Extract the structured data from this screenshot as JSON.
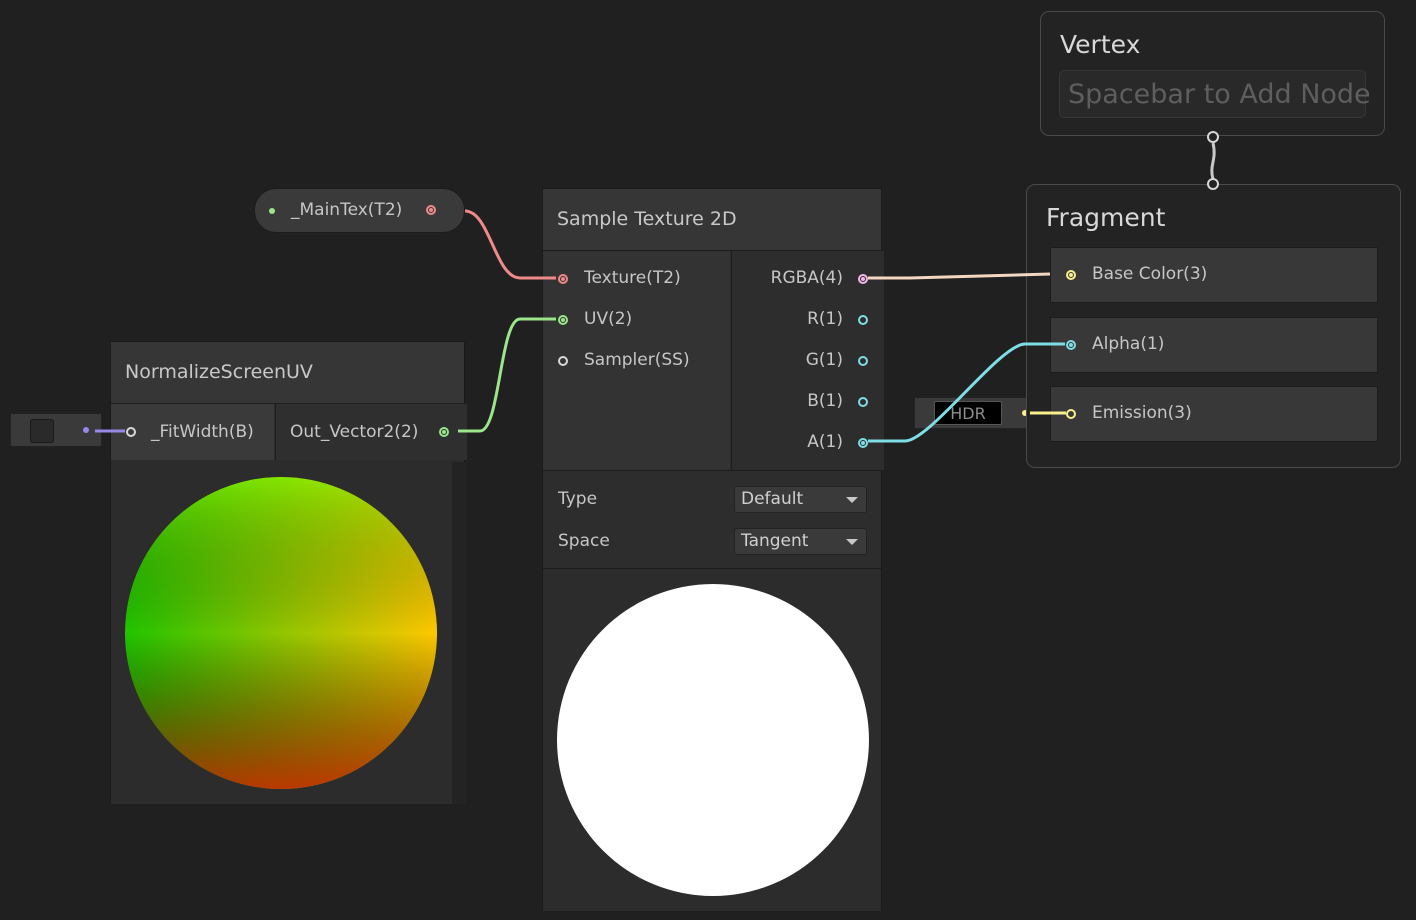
{
  "graph": {
    "property_node": {
      "label": "_MainTex(T2)"
    },
    "sample_texture": {
      "title": "Sample Texture 2D",
      "inputs": [
        "Texture(T2)",
        "UV(2)",
        "Sampler(SS)"
      ],
      "outputs": [
        "RGBA(4)",
        "R(1)",
        "G(1)",
        "B(1)",
        "A(1)"
      ],
      "settings": {
        "type_label": "Type",
        "type_value": "Default",
        "space_label": "Space",
        "space_value": "Tangent"
      }
    },
    "normalize_node": {
      "title": "NormalizeScreenUV",
      "input": "_FitWidth(B)",
      "output": "Out_Vector2(2)"
    },
    "vertex_context": {
      "title": "Vertex",
      "placeholder": "Spacebar to Add Node"
    },
    "fragment_context": {
      "title": "Fragment",
      "blocks": [
        "Base Color(3)",
        "Alpha(1)",
        "Emission(3)"
      ]
    },
    "hdr_field": {
      "label": "HDR"
    }
  },
  "colors": {
    "canvas": "#202020",
    "texture_port": "#f08a8a",
    "vector2_port": "#9be58a",
    "vector4_port": "#f3b7e8",
    "vector3_port": "#f7f08c",
    "float_port": "#7fdde6",
    "boolean_port": "#9a88e8"
  }
}
